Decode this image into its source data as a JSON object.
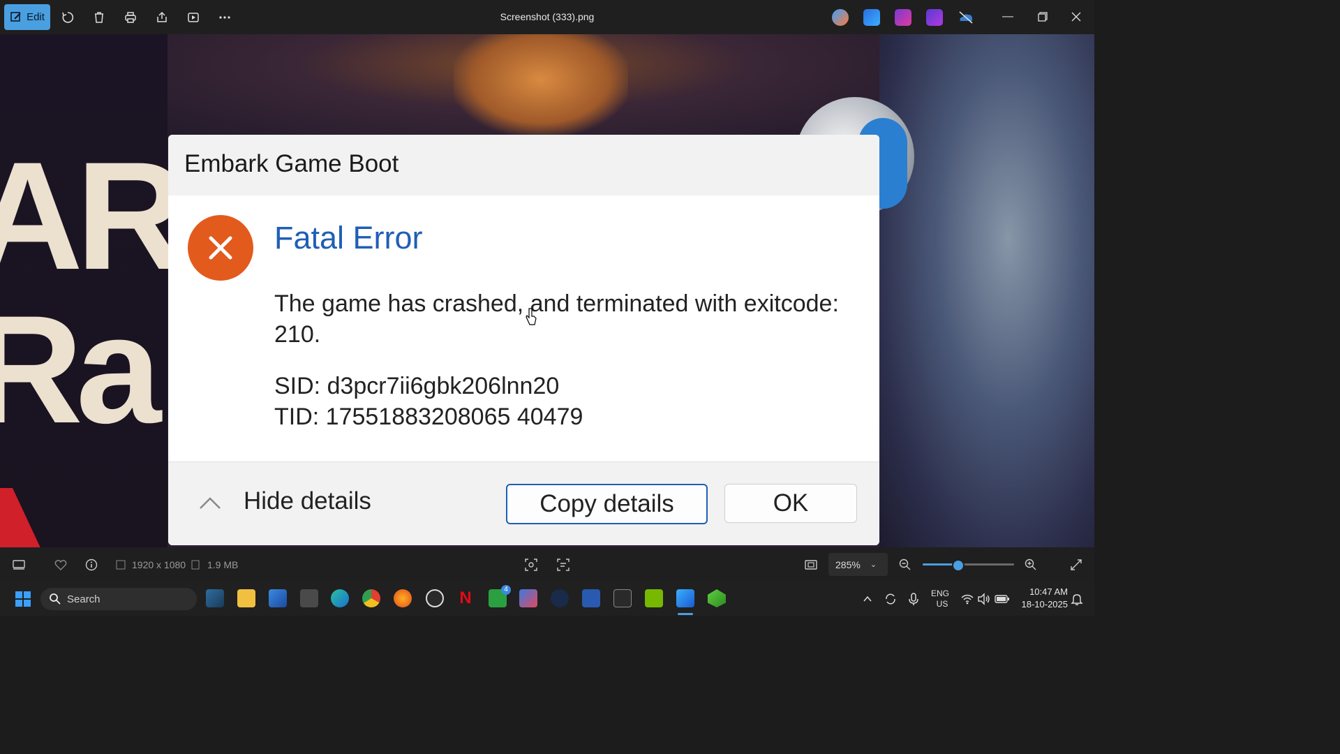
{
  "toolbar": {
    "edit_label": "Edit",
    "title": "Screenshot (333).png",
    "icons": [
      "rotate-icon",
      "delete-icon",
      "print-icon",
      "share-icon",
      "slideshow-icon",
      "more-icon"
    ],
    "apps": [
      "copilot-icon",
      "designer-icon",
      "clipchamp-icon",
      "video-editor-icon",
      "onedrive-icon"
    ]
  },
  "dialog": {
    "window_title": "Embark Game Boot",
    "heading": "Fatal Error",
    "message": "The game has crashed, and terminated with exitcode: 210.",
    "sid": "SID: d3pcr7ii6gbk206lnn20",
    "tid": "TID: 17551883208065 40479",
    "hide_details": "Hide details",
    "copy_details": "Copy details",
    "ok": "OK",
    "colors": {
      "error_icon": "#e35a1d",
      "heading": "#1f5fb5"
    }
  },
  "background": {
    "letters_line1": "AR",
    "letters_line2": "Ra"
  },
  "statusbar": {
    "dimensions": "1920 x 1080",
    "size": "1.9 MB",
    "zoom": "285%",
    "zoom_fraction": 0.38
  },
  "taskbar": {
    "search_placeholder": "Search",
    "xbox_badge": "4",
    "lang_top": "ENG",
    "lang_bottom": "US",
    "time": "10:47 AM",
    "date": "18-10-2025"
  }
}
